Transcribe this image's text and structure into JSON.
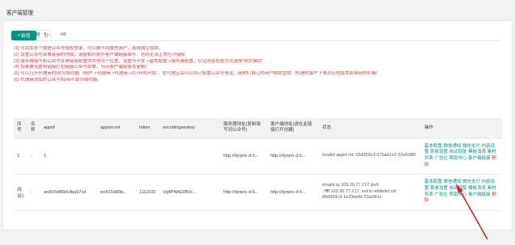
{
  "page_title": "客户端管理",
  "tabs": [
    {
      "label": "公众号",
      "active": true
    },
    {
      "label": "H5",
      "active": false
    }
  ],
  "toolbar": {
    "add_label": "新增",
    "add_icon": "plus-icon",
    "refresh_icon": "refresh-icon"
  },
  "notes": [
    "(1) 可添加多个微信公众号授权登录，可以做不同微信商户，各自独立收款。",
    "(2) 设置公众号菜单链接的时候，请复制列表中客户端链接填写，否则无法正常打开授权",
    "(3) 服务器填写和公众号菜单链接配置中并非同一位置，设置与开发->基本配置->服务器配置，切记消息加密方式选择\"明文模式\"",
    "(4) 如果要设置和链接打包链接公众号菜单，可点客户端链接去复制！",
    "(5) 可以打开代理商的H5分销功能（用户->代理商->代理商->打开H5分销），在代理区后可以自己配置公众号信息，用他们自己的商户收款营销（代理的客户下单对应他成本和降低的价格）",
    "(6) 代理商添加的公众号和H5不算分销功能。"
  ],
  "table": {
    "headers": [
      "序号",
      "名称",
      "appid",
      "appsecret",
      "token",
      "encodingaeskey",
      "服务器地址(复制填写到公众号)",
      "客户端地址(请在此链接打开创建)",
      "状态",
      "操作"
    ],
    "rows": [
      {
        "no": "1",
        "name": "-",
        "appid": "1",
        "appsecret": "",
        "token": "",
        "aeskey": "",
        "server": "http://dyrpro d-5...",
        "client": "http://dyrpro d-5...",
        "status": "invalid appid rid: 65d359c3-076ad1e2-53e63f8f"
      },
      {
        "no": "测试1",
        "name": "-",
        "appid": "wx815d85b64ba97cd",
        "appsecret": "wx815d85b...",
        "token": "1111633",
        "aeskey": "Vg4PNAE0f5Ix...",
        "server": "http://dyrpro d-5...",
        "client": "http://dyrpro d-5...",
        "status": "invalid ip 103.30.77.217 ipv6 ::ffff:103.30.77.217, not in whitelist rid 65d359c3-1e29eefd-72a1fb1c"
      }
    ],
    "ops": {
      "basic": "基本配置",
      "notify": "微信通知",
      "pay": "微信支付",
      "content": "内容设置",
      "menu": "菜单设置",
      "autoreply": "自动回复",
      "template": "模板消息",
      "material": "素材列表",
      "ads": "广告位",
      "help": "帮助中心",
      "client": "客户端链接",
      "delete": "删除"
    }
  },
  "colors": {
    "primary": "#009688",
    "danger": "#e4393c",
    "arrow": "#e02020"
  }
}
